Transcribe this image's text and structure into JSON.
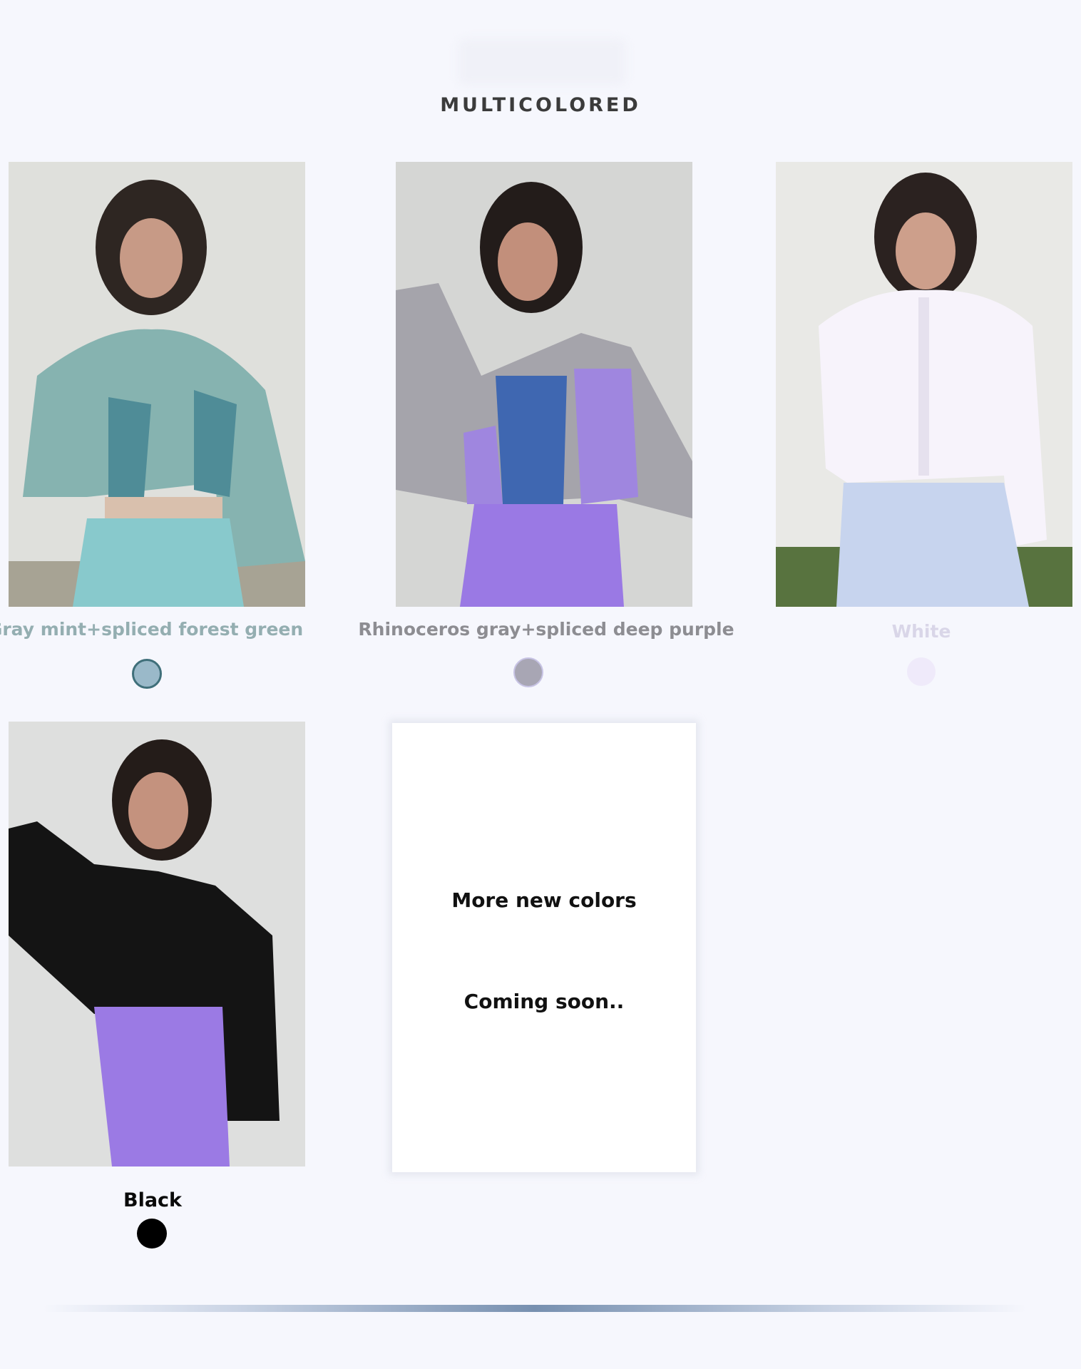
{
  "section": {
    "title": "MULTICOLORED"
  },
  "colors": {
    "page_bg": "#f6f7fd",
    "mint_caption": "#94aeb1",
    "gray_caption": "#8d8d92",
    "white_caption": "#d9d6e8",
    "black_caption": "#0a0a0a"
  },
  "variants": [
    {
      "label": "Gray mint+spliced forest green",
      "swatch": "#9ab9c9",
      "swatch_ring": "#3f6f7a",
      "selected": true
    },
    {
      "label": "Rhinoceros gray+spliced deep purple",
      "swatch": "#a8a6b4",
      "swatch_ring": "#c7c3e4",
      "selected": false
    },
    {
      "label": "White",
      "swatch": "#efeafa",
      "swatch_ring": "#efeafa",
      "selected": false
    },
    {
      "label": "Black",
      "swatch": "#000000",
      "swatch_ring": "#000000",
      "selected": false
    }
  ],
  "coming_soon": {
    "line1": "More new colors",
    "line2": "Coming soon.."
  }
}
